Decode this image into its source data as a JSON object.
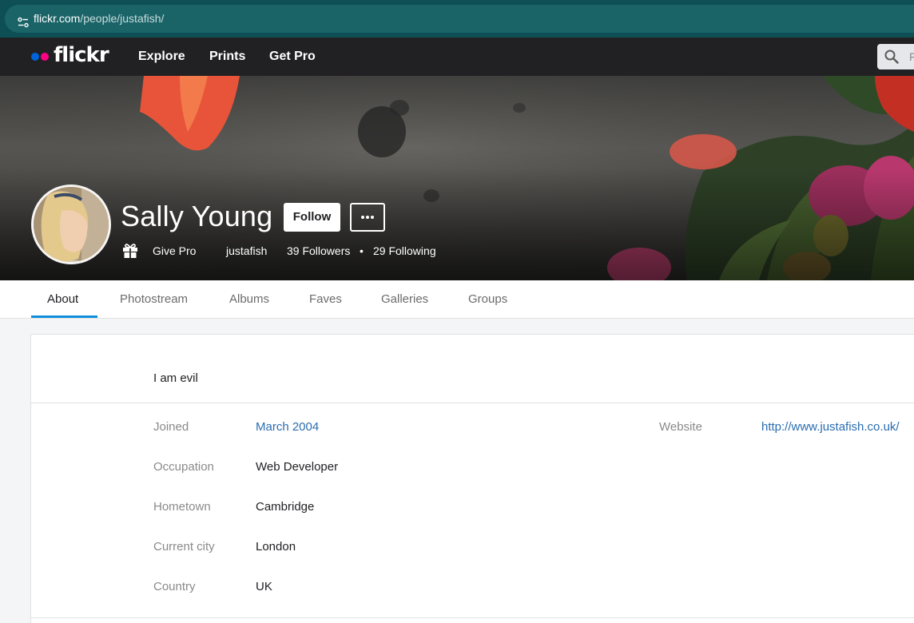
{
  "browser": {
    "url_host": "flickr.com",
    "url_path": "/people/justafish/"
  },
  "nav": {
    "logo_text": "flickr",
    "links": [
      "Explore",
      "Prints",
      "Get Pro"
    ],
    "search_placeholder": "F"
  },
  "profile": {
    "name": "Sally Young",
    "follow_label": "Follow",
    "give_pro_label": "Give Pro",
    "username": "justafish",
    "followers": "39 Followers",
    "separator": "•",
    "following": "29 Following"
  },
  "tabs": [
    "About",
    "Photostream",
    "Albums",
    "Faves",
    "Galleries",
    "Groups"
  ],
  "active_tab": "About",
  "about": {
    "description": "I am evil",
    "fields": [
      {
        "label": "Joined",
        "value": "March 2004",
        "is_link": true
      },
      {
        "label": "Occupation",
        "value": "Web Developer",
        "is_link": false
      },
      {
        "label": "Hometown",
        "value": "Cambridge",
        "is_link": false
      },
      {
        "label": "Current city",
        "value": "London",
        "is_link": false
      },
      {
        "label": "Country",
        "value": "UK",
        "is_link": false
      }
    ],
    "website_label": "Website",
    "website_value": "http://www.justafish.co.uk/"
  },
  "colors": {
    "address_bar": "#0d4f55",
    "nav_bg": "#212124",
    "brand_blue": "#0063dc",
    "brand_pink": "#ff0084",
    "tab_accent": "#128fdc",
    "link": "#2a6db0"
  },
  "icons": [
    "site-settings-icon",
    "search-icon",
    "gift-icon",
    "more-options-icon"
  ]
}
